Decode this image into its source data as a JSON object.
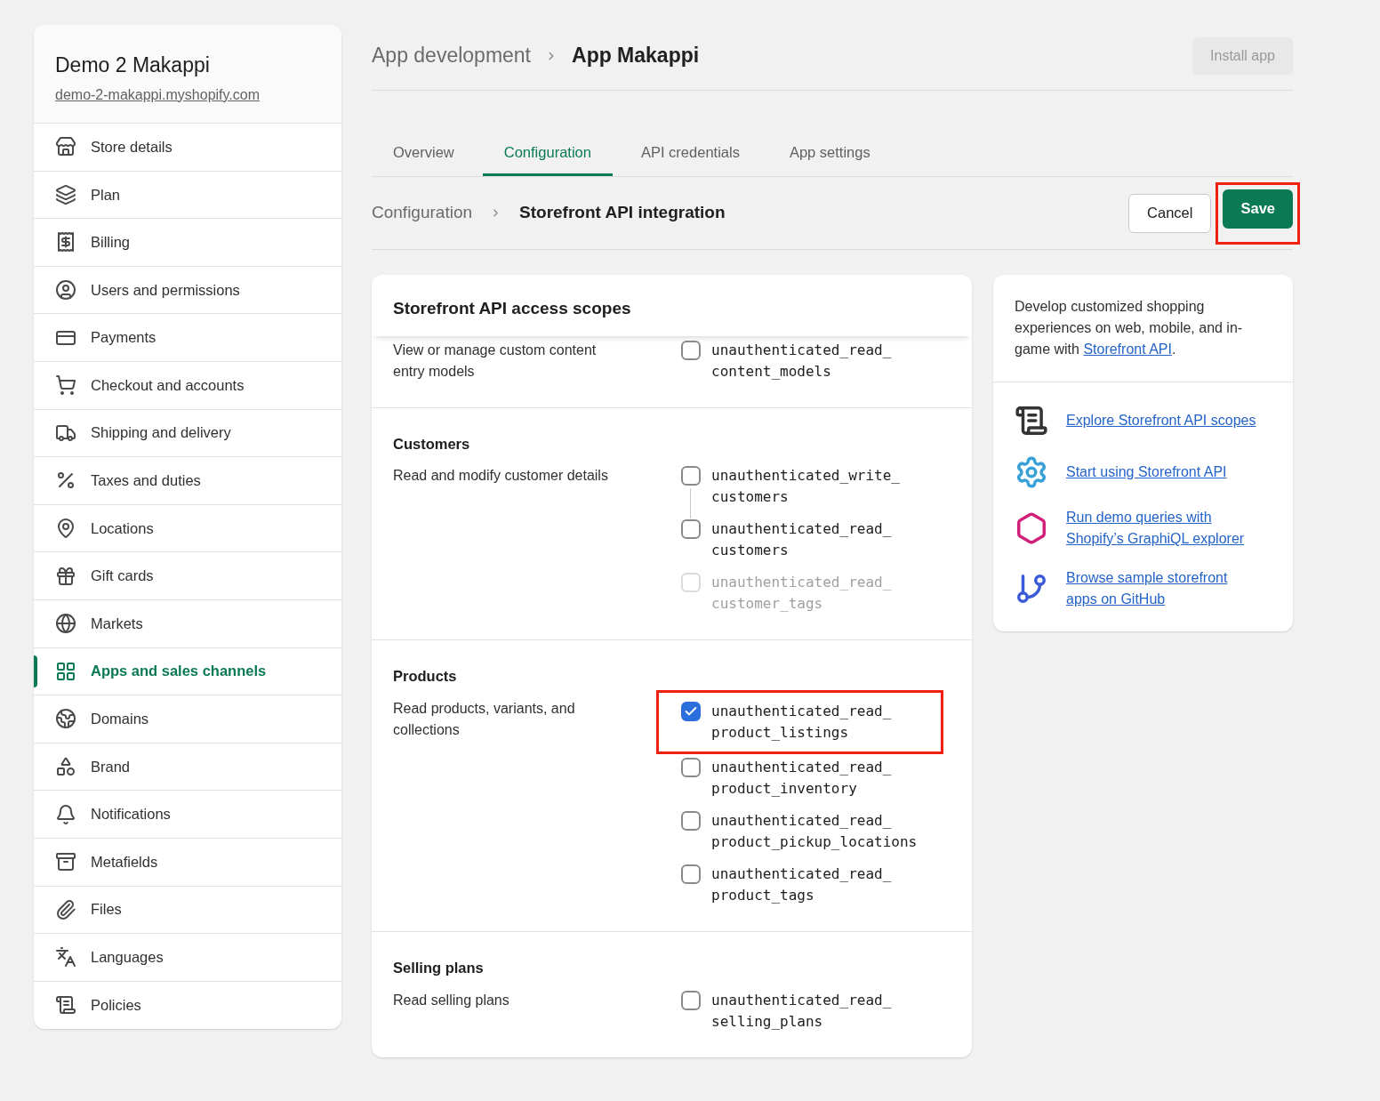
{
  "store": {
    "name": "Demo 2 Makappi",
    "domain": "demo-2-makappi.myshopify.com"
  },
  "sidebar": {
    "items": [
      {
        "label": "Store details",
        "selected": false
      },
      {
        "label": "Plan",
        "selected": false
      },
      {
        "label": "Billing",
        "selected": false
      },
      {
        "label": "Users and permissions",
        "selected": false
      },
      {
        "label": "Payments",
        "selected": false
      },
      {
        "label": "Checkout and accounts",
        "selected": false
      },
      {
        "label": "Shipping and delivery",
        "selected": false
      },
      {
        "label": "Taxes and duties",
        "selected": false
      },
      {
        "label": "Locations",
        "selected": false
      },
      {
        "label": "Gift cards",
        "selected": false
      },
      {
        "label": "Markets",
        "selected": false
      },
      {
        "label": "Apps and sales channels",
        "selected": true
      },
      {
        "label": "Domains",
        "selected": false
      },
      {
        "label": "Brand",
        "selected": false
      },
      {
        "label": "Notifications",
        "selected": false
      },
      {
        "label": "Metafields",
        "selected": false
      },
      {
        "label": "Files",
        "selected": false
      },
      {
        "label": "Languages",
        "selected": false
      },
      {
        "label": "Policies",
        "selected": false
      }
    ]
  },
  "header": {
    "breadcrumb": "App development",
    "title": "App Makappi",
    "action": "Install app"
  },
  "tabs": [
    {
      "label": "Overview",
      "selected": false
    },
    {
      "label": "Configuration",
      "selected": true
    },
    {
      "label": "API credentials",
      "selected": false
    },
    {
      "label": "App settings",
      "selected": false
    }
  ],
  "subheader": {
    "breadcrumb": "Configuration",
    "title": "Storefront API integration",
    "buttons": [
      {
        "label": "Cancel",
        "kind": "secondary",
        "highlighted": false
      },
      {
        "label": "Save",
        "kind": "primary",
        "highlighted": true
      }
    ]
  },
  "scopes_card": {
    "title": "Storefront API access scopes",
    "sections": [
      {
        "description": "View or manage custom content entry models",
        "scopes": [
          {
            "name": "unauthenticated_read_\ncontent_models",
            "checked": false,
            "disabled": false,
            "highlighted": false,
            "linked_to_next": false
          }
        ]
      },
      {
        "title": "Customers",
        "description": "Read and modify customer details",
        "scopes": [
          {
            "name": "unauthenticated_write_\ncustomers",
            "checked": false,
            "disabled": false,
            "highlighted": false,
            "linked_to_next": true
          },
          {
            "name": "unauthenticated_read_\ncustomers",
            "checked": false,
            "disabled": false,
            "highlighted": false,
            "linked_to_next": false
          },
          {
            "name": "unauthenticated_read_\ncustomer_tags",
            "checked": false,
            "disabled": true,
            "highlighted": false,
            "linked_to_next": false
          }
        ]
      },
      {
        "title": "Products",
        "description": "Read products, variants, and collections",
        "scopes": [
          {
            "name": "unauthenticated_read_\nproduct_listings",
            "checked": true,
            "disabled": false,
            "highlighted": true,
            "linked_to_next": false
          },
          {
            "name": "unauthenticated_read_\nproduct_inventory",
            "checked": false,
            "disabled": false,
            "highlighted": false,
            "linked_to_next": false
          },
          {
            "name": "unauthenticated_read_\nproduct_pickup_locations",
            "checked": false,
            "disabled": false,
            "highlighted": false,
            "linked_to_next": false
          },
          {
            "name": "unauthenticated_read_\nproduct_tags",
            "checked": false,
            "disabled": false,
            "highlighted": false,
            "linked_to_next": false
          }
        ]
      },
      {
        "title": "Selling plans",
        "description": "Read selling plans",
        "scopes": [
          {
            "name": "unauthenticated_read_\nselling_plans",
            "checked": false,
            "disabled": false,
            "highlighted": false,
            "linked_to_next": false
          }
        ]
      }
    ]
  },
  "info_card": {
    "intro": "Develop customized shopping experiences on web, mobile, and in-game with",
    "intro_link": "Storefront API",
    "intro_end": ".",
    "links": [
      {
        "label": "Explore Storefront API scopes"
      },
      {
        "label": "Start using Storefront API"
      },
      {
        "label": "Run demo queries with Shopify’s GraphiQL explorer"
      },
      {
        "label": "Browse sample storefront apps on GitHub"
      }
    ]
  }
}
